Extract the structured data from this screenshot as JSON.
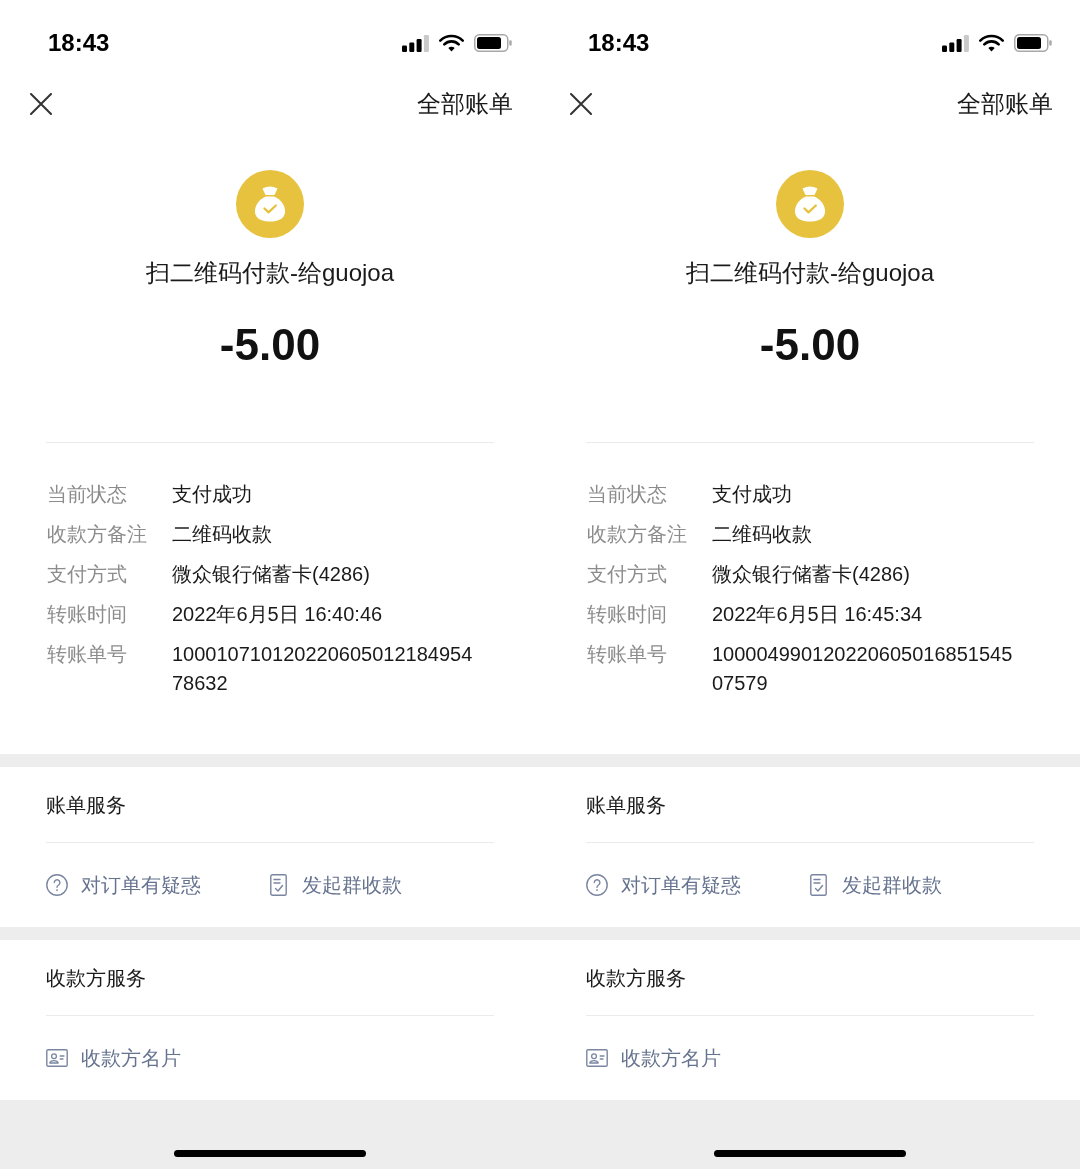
{
  "screens": [
    {
      "status_bar": {
        "time": "18:43"
      },
      "nav": {
        "right_action": "全部账单"
      },
      "summary": {
        "title": "扫二维码付款-给guojoa",
        "amount": "-5.00"
      },
      "details": [
        {
          "label": "当前状态",
          "value": "支付成功"
        },
        {
          "label": "收款方备注",
          "value": "二维码收款"
        },
        {
          "label": "支付方式",
          "value": "微众银行储蓄卡(4286)"
        },
        {
          "label": "转账时间",
          "value": "2022年6月5日 16:40:46"
        },
        {
          "label": "转账单号",
          "value": "10001071012022060501218495478632"
        }
      ],
      "sections": [
        {
          "title": "账单服务",
          "actions": [
            {
              "kind": "help",
              "label": "对订单有疑惑"
            },
            {
              "kind": "receipt",
              "label": "发起群收款"
            }
          ]
        },
        {
          "title": "收款方服务",
          "actions": [
            {
              "kind": "card",
              "label": "收款方名片"
            }
          ]
        }
      ]
    },
    {
      "status_bar": {
        "time": "18:43"
      },
      "nav": {
        "right_action": "全部账单"
      },
      "summary": {
        "title": "扫二维码付款-给guojoa",
        "amount": "-5.00"
      },
      "details": [
        {
          "label": "当前状态",
          "value": "支付成功"
        },
        {
          "label": "收款方备注",
          "value": "二维码收款"
        },
        {
          "label": "支付方式",
          "value": "微众银行储蓄卡(4286)"
        },
        {
          "label": "转账时间",
          "value": "2022年6月5日 16:45:34"
        },
        {
          "label": "转账单号",
          "value": "10000499012022060501685154507579"
        }
      ],
      "sections": [
        {
          "title": "账单服务",
          "actions": [
            {
              "kind": "help",
              "label": "对订单有疑惑"
            },
            {
              "kind": "receipt",
              "label": "发起群收款"
            }
          ]
        },
        {
          "title": "收款方服务",
          "actions": [
            {
              "kind": "card",
              "label": "收款方名片"
            }
          ]
        }
      ]
    }
  ]
}
